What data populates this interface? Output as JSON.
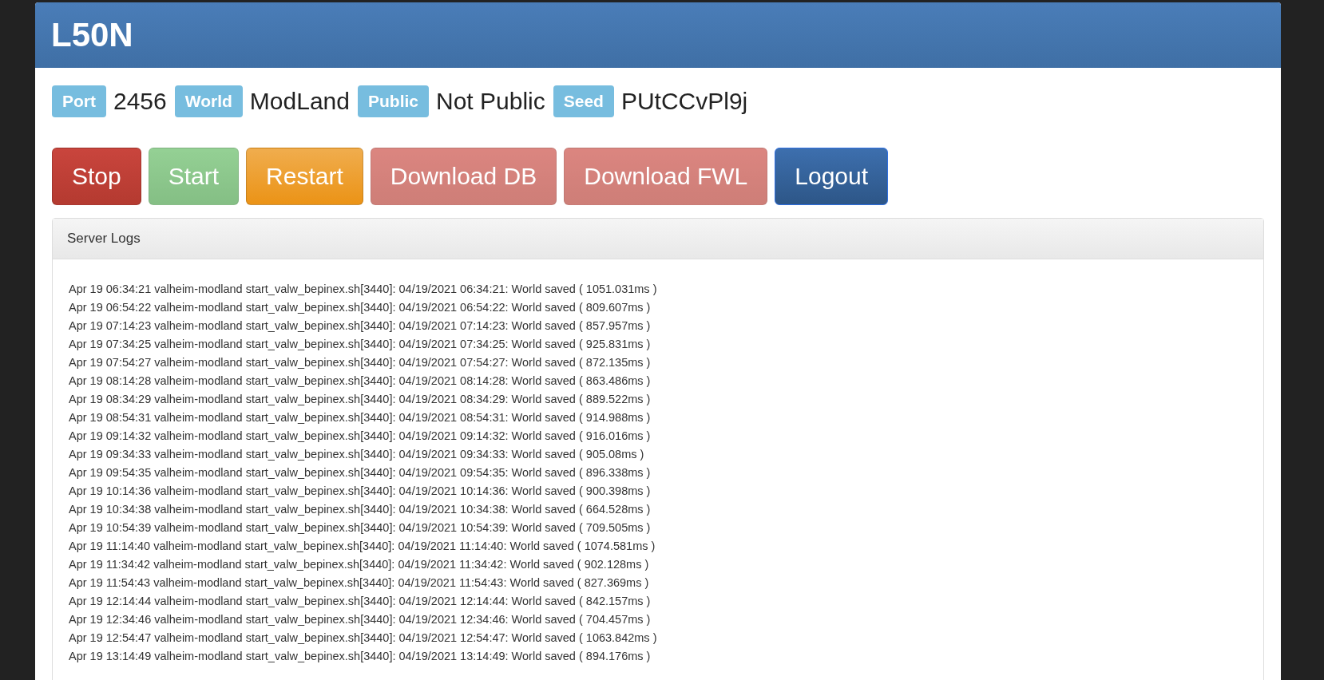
{
  "header": {
    "title": "L50N"
  },
  "info": [
    {
      "label": "Port",
      "value": "2456"
    },
    {
      "label": "World",
      "value": "ModLand"
    },
    {
      "label": "Public",
      "value": "Not Public"
    },
    {
      "label": "Seed",
      "value": "PUtCCvPl9j"
    }
  ],
  "buttons": [
    {
      "label": "Stop",
      "kind": "danger",
      "disabled": false
    },
    {
      "label": "Start",
      "kind": "success",
      "disabled": true
    },
    {
      "label": "Restart",
      "kind": "warning",
      "disabled": false
    },
    {
      "label": "Download DB",
      "kind": "danger",
      "disabled": true
    },
    {
      "label": "Download FWL",
      "kind": "danger",
      "disabled": true
    },
    {
      "label": "Logout",
      "kind": "primary",
      "disabled": false
    }
  ],
  "logs_panel": {
    "title": "Server Logs",
    "lines": [
      "Apr 19 06:34:21 valheim-modland start_valw_bepinex.sh[3440]: 04/19/2021 06:34:21: World saved ( 1051.031ms )",
      "Apr 19 06:54:22 valheim-modland start_valw_bepinex.sh[3440]: 04/19/2021 06:54:22: World saved ( 809.607ms )",
      "Apr 19 07:14:23 valheim-modland start_valw_bepinex.sh[3440]: 04/19/2021 07:14:23: World saved ( 857.957ms )",
      "Apr 19 07:34:25 valheim-modland start_valw_bepinex.sh[3440]: 04/19/2021 07:34:25: World saved ( 925.831ms )",
      "Apr 19 07:54:27 valheim-modland start_valw_bepinex.sh[3440]: 04/19/2021 07:54:27: World saved ( 872.135ms )",
      "Apr 19 08:14:28 valheim-modland start_valw_bepinex.sh[3440]: 04/19/2021 08:14:28: World saved ( 863.486ms )",
      "Apr 19 08:34:29 valheim-modland start_valw_bepinex.sh[3440]: 04/19/2021 08:34:29: World saved ( 889.522ms )",
      "Apr 19 08:54:31 valheim-modland start_valw_bepinex.sh[3440]: 04/19/2021 08:54:31: World saved ( 914.988ms )",
      "Apr 19 09:14:32 valheim-modland start_valw_bepinex.sh[3440]: 04/19/2021 09:14:32: World saved ( 916.016ms )",
      "Apr 19 09:34:33 valheim-modland start_valw_bepinex.sh[3440]: 04/19/2021 09:34:33: World saved ( 905.08ms )",
      "Apr 19 09:54:35 valheim-modland start_valw_bepinex.sh[3440]: 04/19/2021 09:54:35: World saved ( 896.338ms )",
      "Apr 19 10:14:36 valheim-modland start_valw_bepinex.sh[3440]: 04/19/2021 10:14:36: World saved ( 900.398ms )",
      "Apr 19 10:34:38 valheim-modland start_valw_bepinex.sh[3440]: 04/19/2021 10:34:38: World saved ( 664.528ms )",
      "Apr 19 10:54:39 valheim-modland start_valw_bepinex.sh[3440]: 04/19/2021 10:54:39: World saved ( 709.505ms )",
      "Apr 19 11:14:40 valheim-modland start_valw_bepinex.sh[3440]: 04/19/2021 11:14:40: World saved ( 1074.581ms )",
      "Apr 19 11:34:42 valheim-modland start_valw_bepinex.sh[3440]: 04/19/2021 11:34:42: World saved ( 902.128ms )",
      "Apr 19 11:54:43 valheim-modland start_valw_bepinex.sh[3440]: 04/19/2021 11:54:43: World saved ( 827.369ms )",
      "Apr 19 12:14:44 valheim-modland start_valw_bepinex.sh[3440]: 04/19/2021 12:14:44: World saved ( 842.157ms )",
      "Apr 19 12:34:46 valheim-modland start_valw_bepinex.sh[3440]: 04/19/2021 12:34:46: World saved ( 704.457ms )",
      "Apr 19 12:54:47 valheim-modland start_valw_bepinex.sh[3440]: 04/19/2021 12:54:47: World saved ( 1063.842ms )",
      "Apr 19 13:14:49 valheim-modland start_valw_bepinex.sh[3440]: 04/19/2021 13:14:49: World saved ( 894.176ms )"
    ]
  }
}
